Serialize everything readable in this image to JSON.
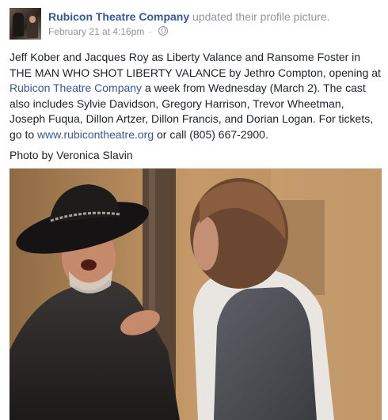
{
  "post": {
    "page_name": "Rubicon Theatre Company",
    "action": "updated their profile picture.",
    "timestamp": "February 21 at 4:16pm",
    "separator": "·",
    "privacy_icon": "globe-icon",
    "text": {
      "part1": "Jeff Kober and Jacques Roy as Liberty Valance and Ransome Foster in THE MAN WHO SHOT LIBERTY VALANCE by Jethro Compton, opening at ",
      "mention": "Rubicon Theatre Company",
      "part2": " a week from Wednesday (March 2). The cast also includes Sylvie Davidson, Gregory Harrison, Trevor Wheetman, Joseph Fuqua, Dillon Artzer, Dillon Francis, and Dorian Logan. For tickets, go to ",
      "url": "www.rubicontheatre.org",
      "part3": " or call (805) 667-2900."
    },
    "photo_credit": "Photo by Veronica Slavin"
  },
  "colors": {
    "link": "#365899",
    "meta": "#90949c",
    "text": "#1d2129"
  }
}
